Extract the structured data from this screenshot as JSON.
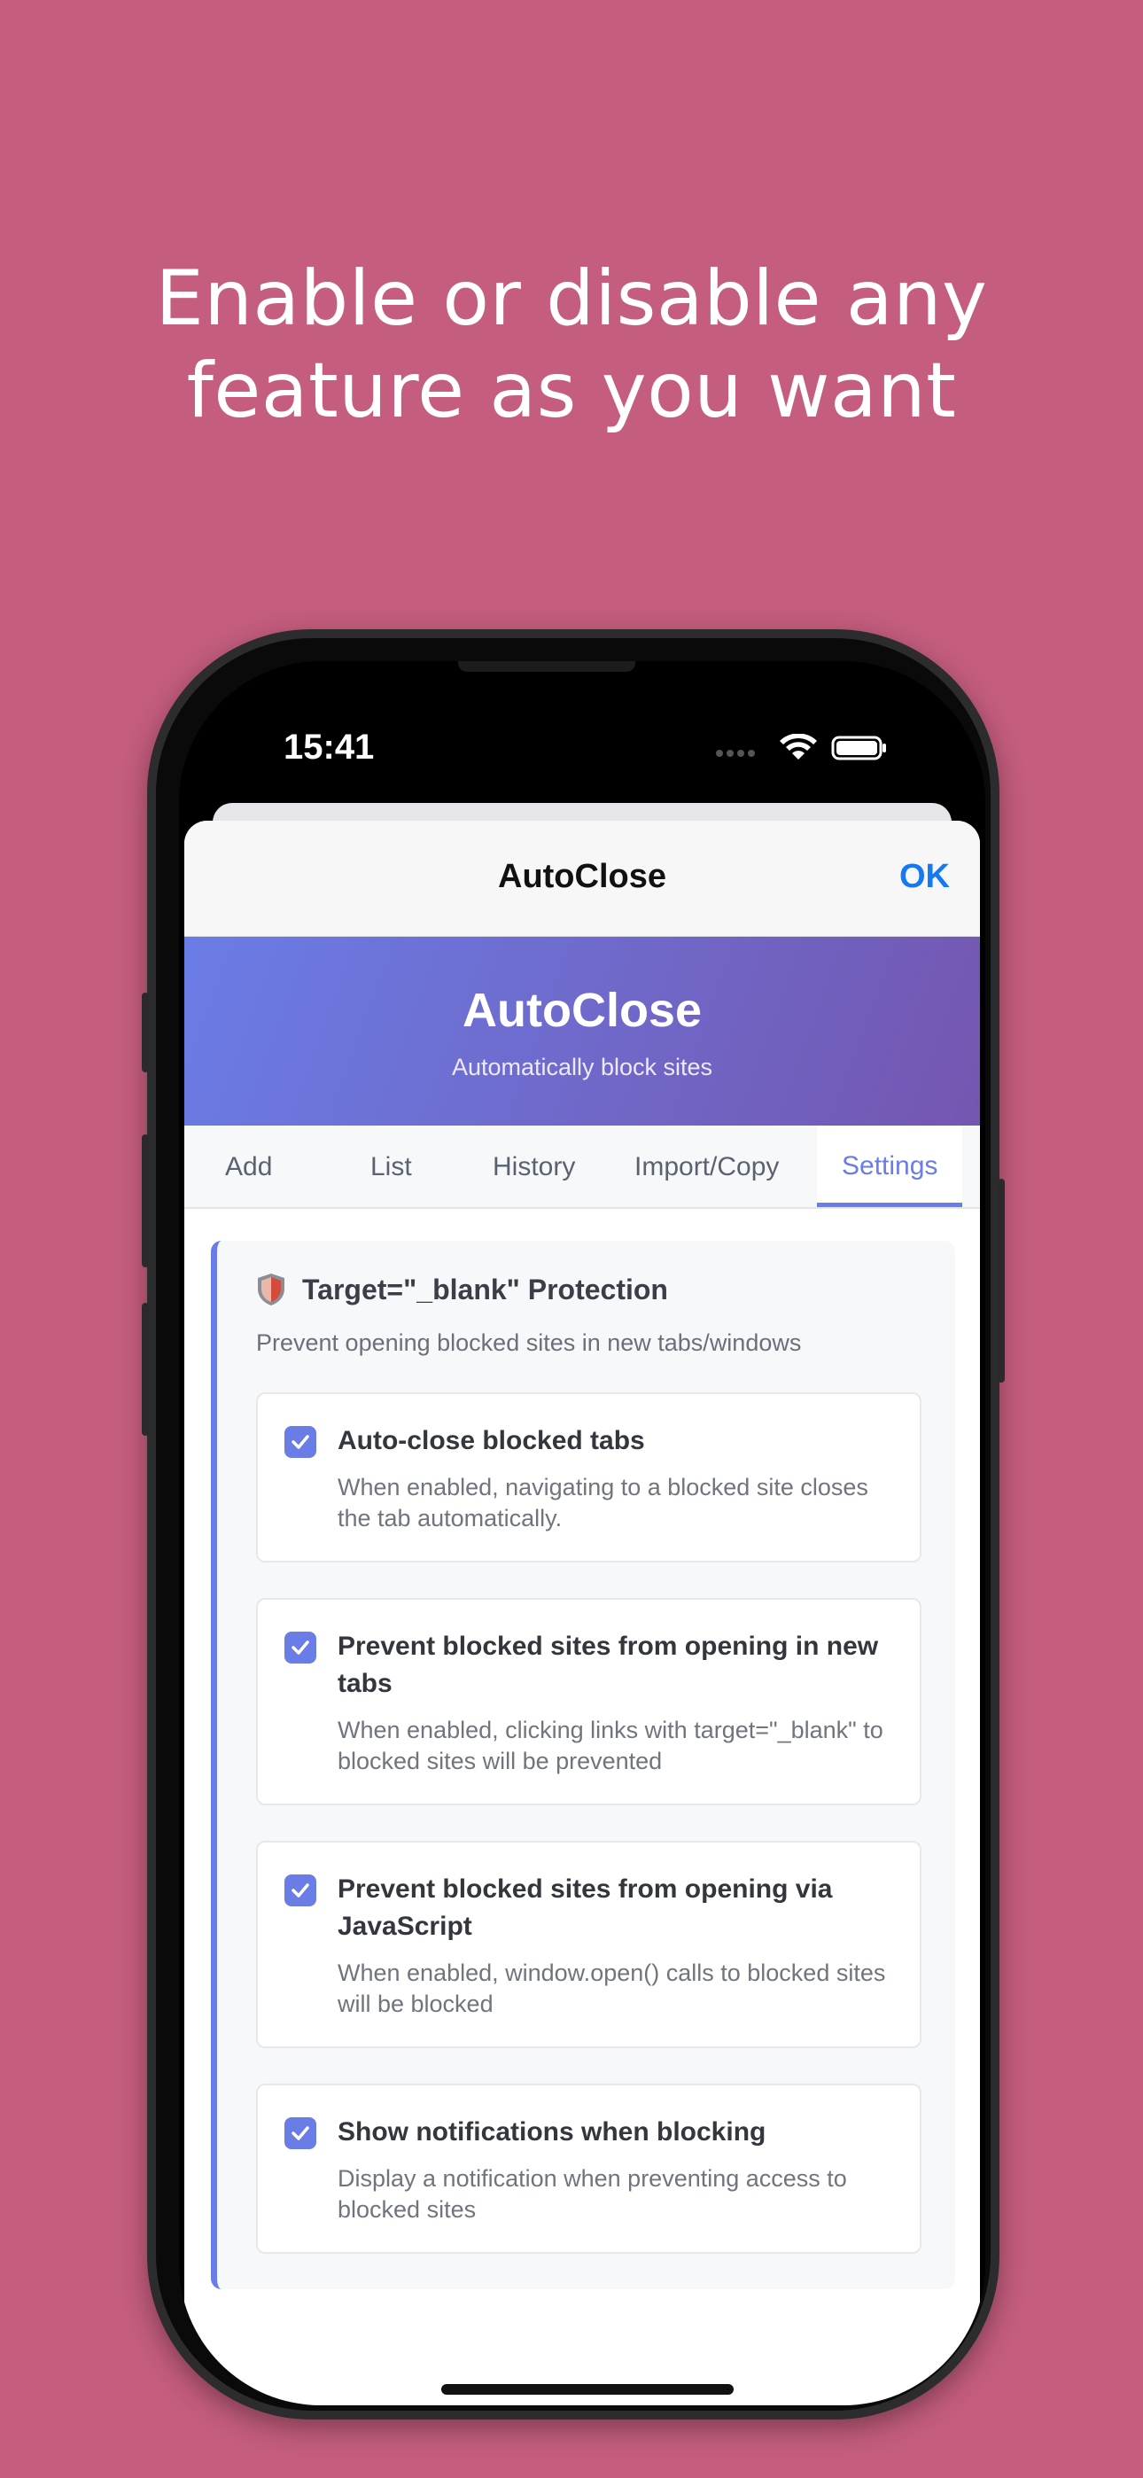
{
  "headline": {
    "line1": "Enable or disable any",
    "line2": "feature as you want"
  },
  "status": {
    "time": "15:41"
  },
  "navbar": {
    "title": "AutoClose",
    "ok": "OK"
  },
  "hero": {
    "title": "AutoClose",
    "subtitle": "Automatically block sites"
  },
  "tabs": [
    "Add",
    "List",
    "History",
    "Import/Copy",
    "Settings"
  ],
  "active_tab": "Settings",
  "section": {
    "title": "Target=\"_blank\" Protection",
    "description": "Prevent opening blocked sites in new tabs/windows",
    "options": [
      {
        "title": "Auto-close blocked tabs",
        "description": "When enabled, navigating to a blocked site closes the tab automatically.",
        "checked": true
      },
      {
        "title": "Prevent blocked sites from opening in new tabs",
        "description": "When enabled, clicking links with target=\"_blank\" to blocked sites will be prevented",
        "checked": true
      },
      {
        "title": "Prevent blocked sites from opening via JavaScript",
        "description": "When enabled, window.open() calls to blocked sites will be blocked",
        "checked": true
      },
      {
        "title": "Show notifications when blocking",
        "description": "Display a notification when preventing access to blocked sites",
        "checked": true
      }
    ]
  },
  "colors": {
    "background": "#c45d7e",
    "accent": "#6a7de6",
    "ok_button": "#1479f4"
  },
  "icons": {
    "section": "shield-icon",
    "checkbox": "checkmark-icon"
  }
}
